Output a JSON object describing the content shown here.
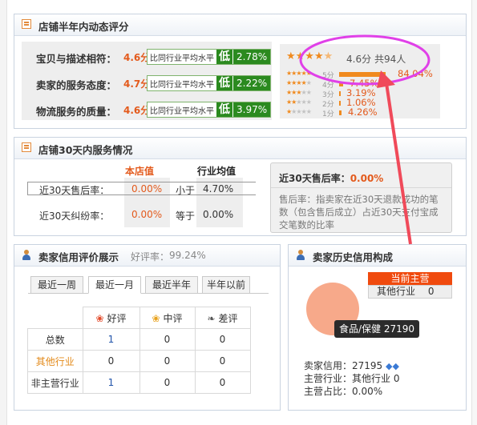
{
  "dynamic_rating": {
    "title": "店铺半年内动态评分",
    "rows": [
      {
        "label": "宝贝与描述相符：",
        "score": "4.6分",
        "compare_text": "比同行业平均水平",
        "level": "低",
        "percent": "2.78%"
      },
      {
        "label": "卖家的服务态度：",
        "score": "4.7分",
        "compare_text": "比同行业平均水平",
        "level": "低",
        "percent": "2.22%"
      },
      {
        "label": "物流服务的质量：",
        "score": "4.6分",
        "compare_text": "比同行业平均水平",
        "level": "低",
        "percent": "3.97%"
      }
    ],
    "summary": {
      "stars": 4.5,
      "score": "4.6分",
      "count": "共94人"
    },
    "distribution": [
      {
        "stars": 5,
        "level": "5分",
        "percent": "84.04%",
        "fraction": 0.8404
      },
      {
        "stars": 4,
        "level": "4分",
        "percent": "7.45%",
        "fraction": 0.0745
      },
      {
        "stars": 3,
        "level": "3分",
        "percent": "3.19%",
        "fraction": 0.0319
      },
      {
        "stars": 2,
        "level": "2分",
        "percent": "1.06%",
        "fraction": 0.0106
      },
      {
        "stars": 1,
        "level": "1分",
        "percent": "4.26%",
        "fraction": 0.0426
      }
    ]
  },
  "service30": {
    "title": "店铺30天内服务情况",
    "col_shop": "本店值",
    "col_industry": "行业均值",
    "rows": [
      {
        "label": "近30天售后率：",
        "shop": "0.00%",
        "relation": "小于",
        "industry": "4.70%"
      },
      {
        "label": "近30天纠纷率：",
        "shop": "0.00%",
        "relation": "等于",
        "industry": "0.00%"
      }
    ],
    "tooltip_title": "近30天售后率：",
    "tooltip_value": "0.00%",
    "tooltip_desc": "售后率：指卖家在近30天退款成功的笔数（包含售后成立）占近30天支付宝成交笔数的比率"
  },
  "credit": {
    "title": "卖家信用评价展示",
    "good_rate_label": "好评率：",
    "good_rate": "99.24%",
    "tabs": [
      "最近一周",
      "最近一月",
      "最近半年",
      "半年以前"
    ],
    "active_tab": 1,
    "headers": [
      "好评",
      "中评",
      "差评"
    ],
    "rows": [
      {
        "label": "总数",
        "values": [
          "1",
          "0",
          "0"
        ]
      },
      {
        "label": "其他行业",
        "values": [
          "0",
          "0",
          "0"
        ]
      },
      {
        "label": "非主营行业",
        "values": [
          "1",
          "0",
          "0"
        ]
      }
    ]
  },
  "history": {
    "title": "卖家历史信用构成",
    "legend_current": "当前主营",
    "legend_other": "其他行业",
    "legend_other_value": "0",
    "tooltip": "食品/保健 27190",
    "seller_credit_label": "卖家信用：",
    "seller_credit_value": "27195",
    "main_industry_label": "主营行业：",
    "main_industry_value": "其他行业 0",
    "main_share_label": "主营占比：",
    "main_share_value": "0.00%"
  },
  "colors": {
    "accent": "#e35a1c",
    "green": "#2b8a1f",
    "arrow": "#f04a5a",
    "highlight_ring": "#e040e8",
    "pie": "#f7a98a"
  }
}
